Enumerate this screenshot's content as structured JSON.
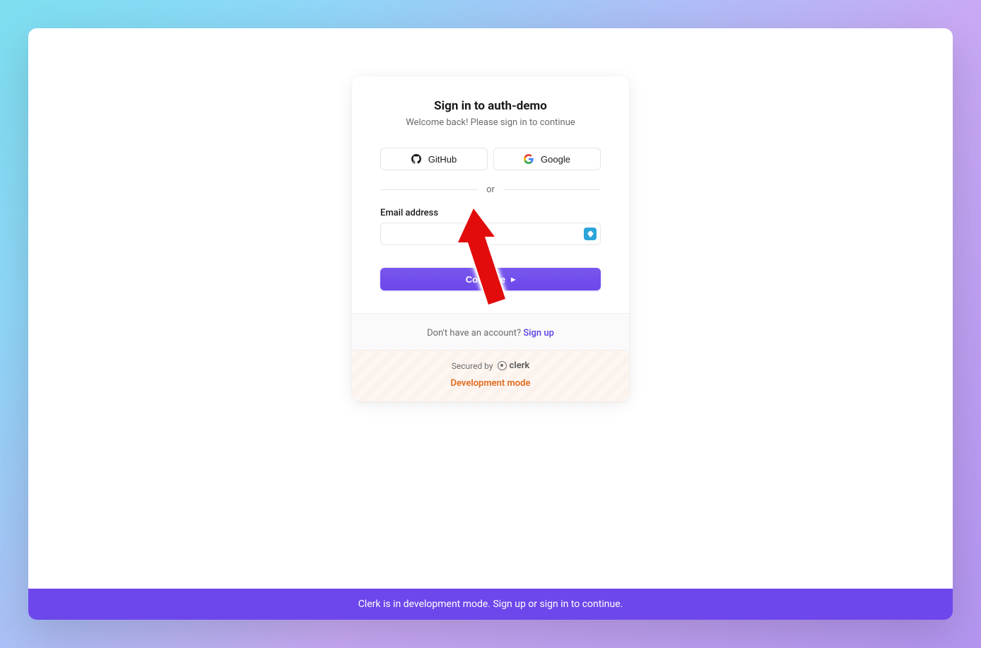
{
  "card": {
    "title": "Sign in to auth-demo",
    "subtitle": "Welcome back! Please sign in to continue"
  },
  "oauth": {
    "github_label": "GitHub",
    "google_label": "Google"
  },
  "divider": {
    "text": "or"
  },
  "form": {
    "email_label": "Email address",
    "email_value": "",
    "continue_label": "Continue"
  },
  "footer": {
    "no_account_text": "Don't have an account? ",
    "signup_label": "Sign up",
    "secured_text": "Secured by",
    "clerk_brand": "clerk",
    "dev_mode": "Development mode"
  },
  "statusbar": {
    "text": "Clerk is in development mode. Sign up or sign in to continue."
  }
}
